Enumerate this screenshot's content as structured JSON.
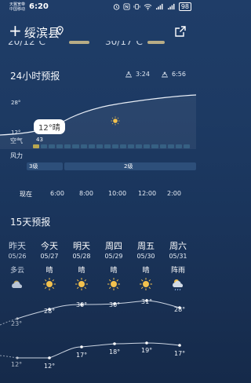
{
  "status": {
    "carrier1": "天翼宽带",
    "carrier2": "中国移动",
    "time": "6:20",
    "battery": "98"
  },
  "header": {
    "add_label": "+",
    "city": "绥滨县"
  },
  "peek": {
    "left": "20/12℃",
    "right": "30/17℃"
  },
  "hourly": {
    "title": "24小时预报",
    "sunrise": "3:24",
    "sunset": "6:56",
    "temp_high": "28°",
    "temp_low": "12°",
    "current_tag": "12°晴",
    "air_label": "空气",
    "air_value": "43",
    "wind_label": "风力",
    "wind_levels": [
      "3级",
      "2级"
    ],
    "times": [
      "现在",
      "6:00",
      "8:00",
      "10:00",
      "12:00",
      "2:00"
    ]
  },
  "daily": {
    "title": "15天预报",
    "days": [
      {
        "name": "昨天",
        "date": "05/26",
        "cond": "多云",
        "high": "23°",
        "low": "12°"
      },
      {
        "name": "今天",
        "date": "05/27",
        "cond": "晴",
        "high": "28°",
        "low": "12°"
      },
      {
        "name": "明天",
        "date": "05/28",
        "cond": "晴",
        "high": "30°",
        "low": "17°"
      },
      {
        "name": "周四",
        "date": "05/29",
        "cond": "晴",
        "high": "30°",
        "low": "18°"
      },
      {
        "name": "周五",
        "date": "05/30",
        "cond": "晴",
        "high": "31°",
        "low": "19°"
      },
      {
        "name": "周六",
        "date": "05/31",
        "cond": "阵雨",
        "high": "28°",
        "low": "17°"
      }
    ]
  },
  "colors": {
    "accent_sun": "#f2c14e",
    "bg": "#1d3a63"
  }
}
